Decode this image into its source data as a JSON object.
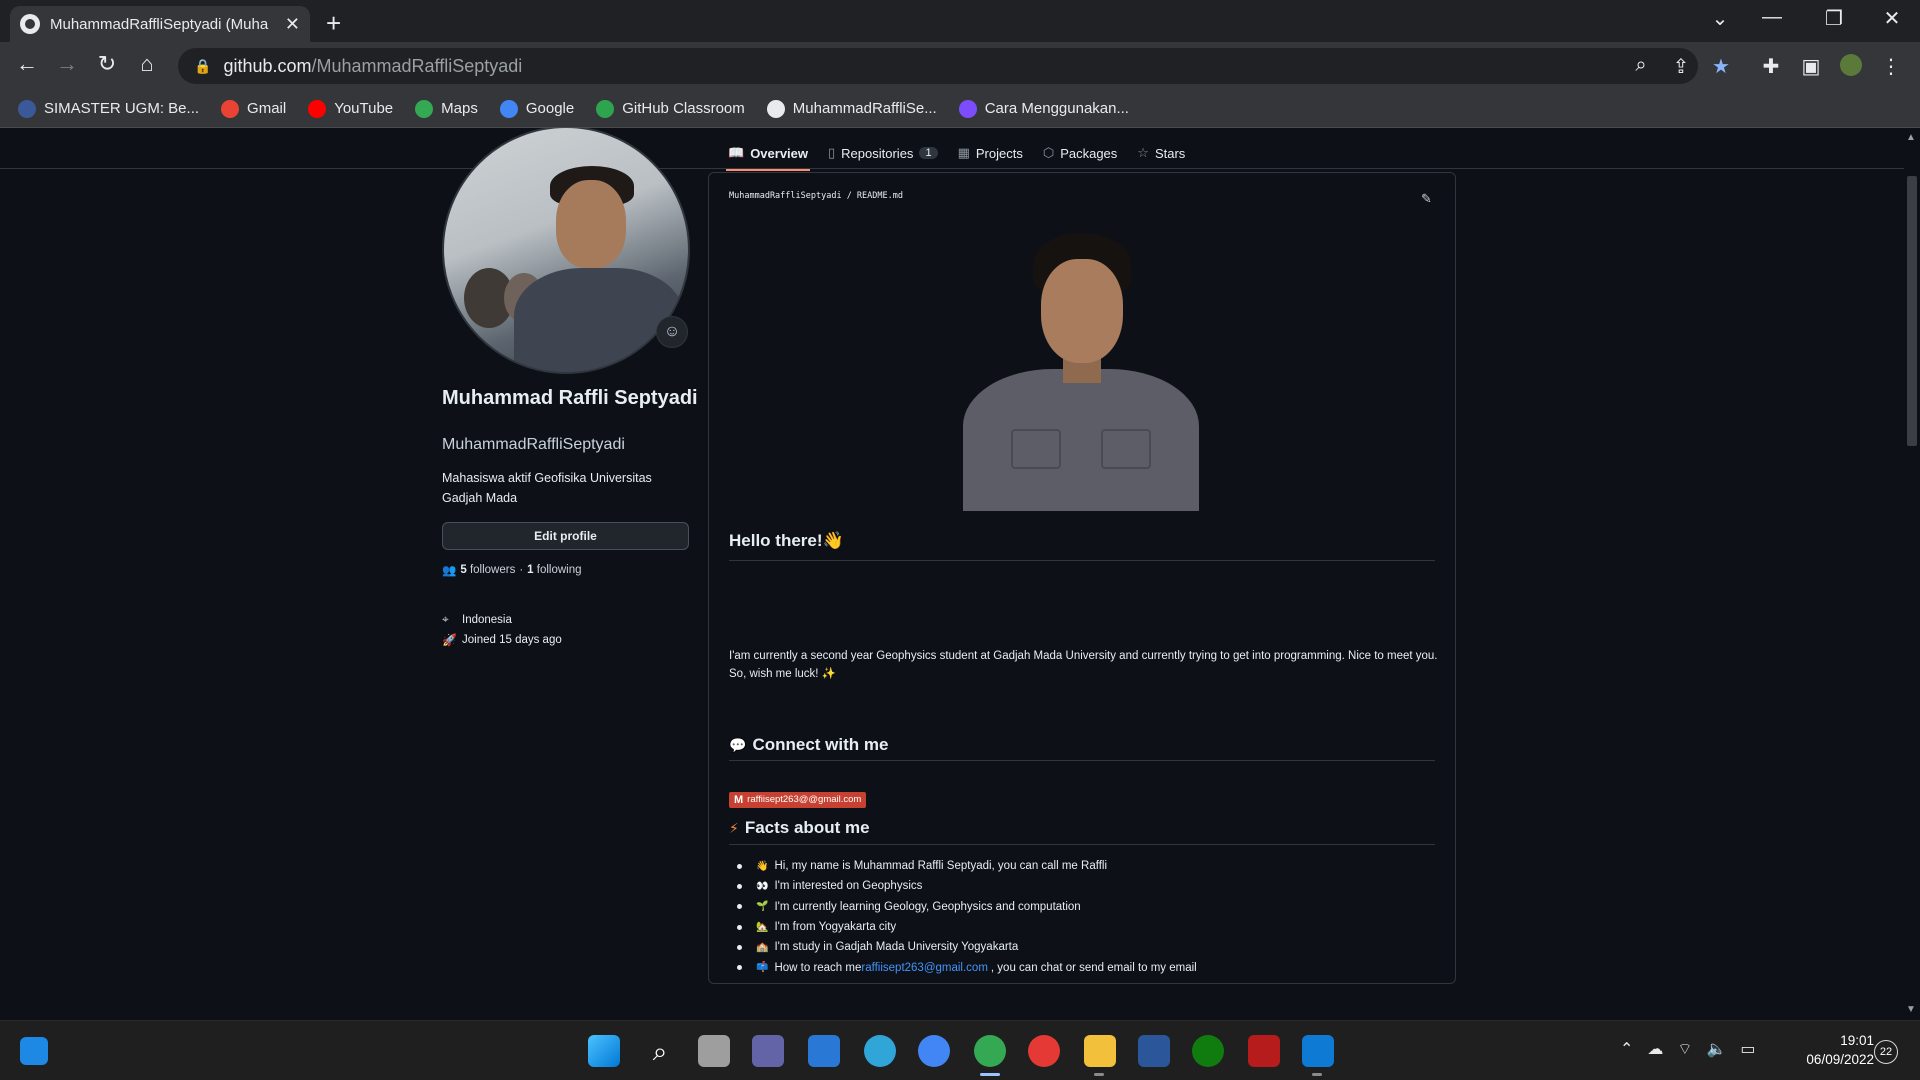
{
  "browser": {
    "tab_title": "MuhammadRaffliSeptyadi (Muha",
    "url_host": "github.com",
    "url_path": "/MuhammadRaffliSeptyadi",
    "bookmarks": [
      {
        "label": "SIMASTER UGM: Be...",
        "icon": "simaster-icon",
        "color": "#3b5998"
      },
      {
        "label": "Gmail",
        "icon": "gmail-icon",
        "color": "#ea4335"
      },
      {
        "label": "YouTube",
        "icon": "youtube-icon",
        "color": "#ff0000"
      },
      {
        "label": "Maps",
        "icon": "maps-icon",
        "color": "#34a853"
      },
      {
        "label": "Google",
        "icon": "google-icon",
        "color": "#4285f4"
      },
      {
        "label": "GitHub Classroom",
        "icon": "github-classroom-icon",
        "color": "#2ea44f"
      },
      {
        "label": "MuhammadRaffliSe...",
        "icon": "github-icon",
        "color": "#e8eaed"
      },
      {
        "label": "Cara Menggunakan...",
        "icon": "bookmark-page-icon",
        "color": "#7c4dff"
      }
    ]
  },
  "nav": {
    "overview": "Overview",
    "repositories": "Repositories",
    "repositories_count": "1",
    "projects": "Projects",
    "packages": "Packages",
    "stars": "Stars"
  },
  "profile": {
    "full_name": "Muhammad Raffli Septyadi",
    "username": "MuhammadRaffliSeptyadi",
    "bio": "Mahasiswa aktif Geofisika Universitas Gadjah Mada",
    "edit_profile": "Edit profile",
    "followers_count": "5",
    "followers_label": "followers",
    "separator": "·",
    "following_count": "1",
    "following_label": "following",
    "location": "Indonesia",
    "joined": "Joined 15 days ago"
  },
  "readme": {
    "path": "MuhammadRaffliSeptyadi / README.md",
    "hello_heading": "Hello there!",
    "hello_emoji": "👋",
    "intro": "I'am currently a second year Geophysics student at Gadjah Mada University and currently trying to get into programming. Nice to meet you. So, wish me luck! ✨",
    "connect_heading": "Connect with me",
    "connect_emoji": "💬",
    "gmail_badge": "raffiisept263@@gmail.com",
    "facts_heading": "Facts about me",
    "facts_emoji": "⚡",
    "facts": [
      {
        "emoji": "👋",
        "text": "Hi, my name is Muhammad Raffli Septyadi, you can call me Raffli"
      },
      {
        "emoji": "👀",
        "text": "I'm interested on Geophysics"
      },
      {
        "emoji": "🌱",
        "text": "I'm currently learning Geology, Geophysics and computation"
      },
      {
        "emoji": "🏡",
        "text": "I'm from Yogyakarta city"
      },
      {
        "emoji": "🏫",
        "text": "I'm study in Gadjah Mada University Yogyakarta"
      },
      {
        "emoji": "📫",
        "text": "How to reach me",
        "link": "raffiisept263@gmail.com",
        "suffix": ", you can chat or send email to my email"
      }
    ]
  },
  "taskbar": {
    "time": "19:01",
    "date": "06/09/2022",
    "notifications": "22"
  }
}
